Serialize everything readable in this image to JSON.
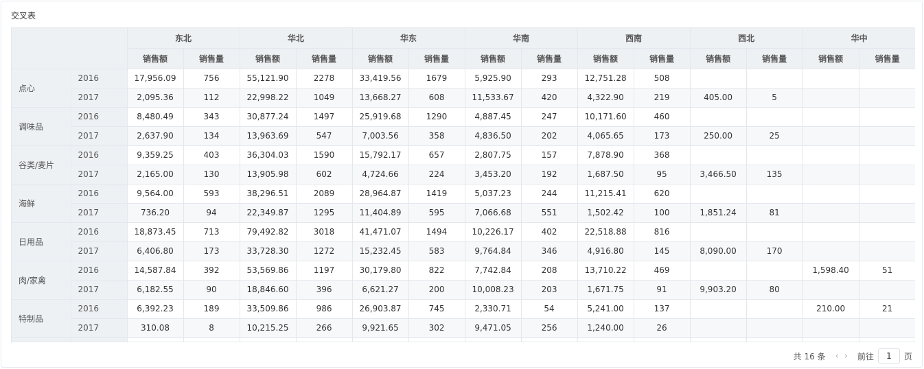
{
  "title": "交叉表",
  "regions": [
    "东北",
    "华北",
    "华东",
    "华南",
    "西南",
    "西北",
    "华中"
  ],
  "measures": [
    "销售额",
    "销售量"
  ],
  "categories": [
    {
      "name": "点心",
      "rows": [
        {
          "year": "2016",
          "values": [
            "17,956.09",
            "756",
            "55,121.90",
            "2278",
            "33,419.56",
            "1679",
            "5,925.90",
            "293",
            "12,751.28",
            "508",
            "",
            "",
            "",
            ""
          ]
        },
        {
          "year": "2017",
          "values": [
            "2,095.36",
            "112",
            "22,998.22",
            "1049",
            "13,668.27",
            "608",
            "11,533.67",
            "420",
            "4,322.90",
            "219",
            "405.00",
            "5",
            "",
            ""
          ]
        }
      ]
    },
    {
      "name": "调味品",
      "rows": [
        {
          "year": "2016",
          "values": [
            "8,480.49",
            "343",
            "30,877.24",
            "1497",
            "25,919.68",
            "1290",
            "4,887.45",
            "247",
            "10,171.60",
            "460",
            "",
            "",
            "",
            ""
          ]
        },
        {
          "year": "2017",
          "values": [
            "2,637.90",
            "134",
            "13,963.69",
            "547",
            "7,003.56",
            "358",
            "4,836.50",
            "202",
            "4,065.65",
            "173",
            "250.00",
            "25",
            "",
            ""
          ]
        }
      ]
    },
    {
      "name": "谷类/麦片",
      "rows": [
        {
          "year": "2016",
          "values": [
            "9,359.25",
            "403",
            "36,304.03",
            "1590",
            "15,792.17",
            "657",
            "2,807.75",
            "157",
            "7,878.90",
            "368",
            "",
            "",
            "",
            ""
          ]
        },
        {
          "year": "2017",
          "values": [
            "2,165.00",
            "130",
            "13,905.98",
            "602",
            "4,724.66",
            "224",
            "3,453.20",
            "192",
            "1,687.50",
            "95",
            "3,466.50",
            "135",
            "",
            ""
          ]
        }
      ]
    },
    {
      "name": "海鲜",
      "rows": [
        {
          "year": "2016",
          "values": [
            "9,564.00",
            "593",
            "38,296.51",
            "2089",
            "28,964.87",
            "1419",
            "5,037.23",
            "244",
            "11,215.41",
            "620",
            "",
            "",
            "",
            ""
          ]
        },
        {
          "year": "2017",
          "values": [
            "736.20",
            "94",
            "22,349.87",
            "1295",
            "11,404.89",
            "595",
            "7,066.68",
            "551",
            "1,502.42",
            "100",
            "1,851.24",
            "81",
            "",
            ""
          ]
        }
      ]
    },
    {
      "name": "日用品",
      "rows": [
        {
          "year": "2016",
          "values": [
            "18,873.45",
            "713",
            "79,492.82",
            "3018",
            "41,471.07",
            "1494",
            "10,226.17",
            "402",
            "22,518.88",
            "816",
            "",
            "",
            "",
            ""
          ]
        },
        {
          "year": "2017",
          "values": [
            "6,406.80",
            "173",
            "33,728.30",
            "1272",
            "15,232.45",
            "583",
            "9,764.84",
            "346",
            "4,916.80",
            "145",
            "8,090.00",
            "170",
            "",
            ""
          ]
        }
      ]
    },
    {
      "name": "肉/家禽",
      "rows": [
        {
          "year": "2016",
          "values": [
            "14,587.84",
            "392",
            "53,569.86",
            "1197",
            "30,179.80",
            "822",
            "7,742.84",
            "208",
            "13,710.22",
            "469",
            "",
            "",
            "1,598.40",
            "51"
          ]
        },
        {
          "year": "2017",
          "values": [
            "6,182.55",
            "90",
            "18,846.60",
            "396",
            "6,621.27",
            "200",
            "10,008.23",
            "203",
            "1,671.75",
            "91",
            "9,903.20",
            "80",
            "",
            ""
          ]
        }
      ]
    },
    {
      "name": "特制品",
      "rows": [
        {
          "year": "2016",
          "values": [
            "6,392.23",
            "189",
            "33,509.86",
            "986",
            "26,903.87",
            "745",
            "2,330.71",
            "54",
            "5,241.00",
            "137",
            "",
            "",
            "210.00",
            "21"
          ]
        },
        {
          "year": "2017",
          "values": [
            "310.08",
            "8",
            "10,215.25",
            "266",
            "9,921.65",
            "302",
            "9,471.05",
            "256",
            "1,240.00",
            "26",
            "",
            "",
            "",
            ""
          ]
        }
      ]
    }
  ],
  "pager": {
    "total": "共 16 条",
    "prev_icon": "chevron-left-icon",
    "next_icon": "chevron-right-icon",
    "goto_label": "前往",
    "page_value": "1",
    "page_word": "页"
  }
}
